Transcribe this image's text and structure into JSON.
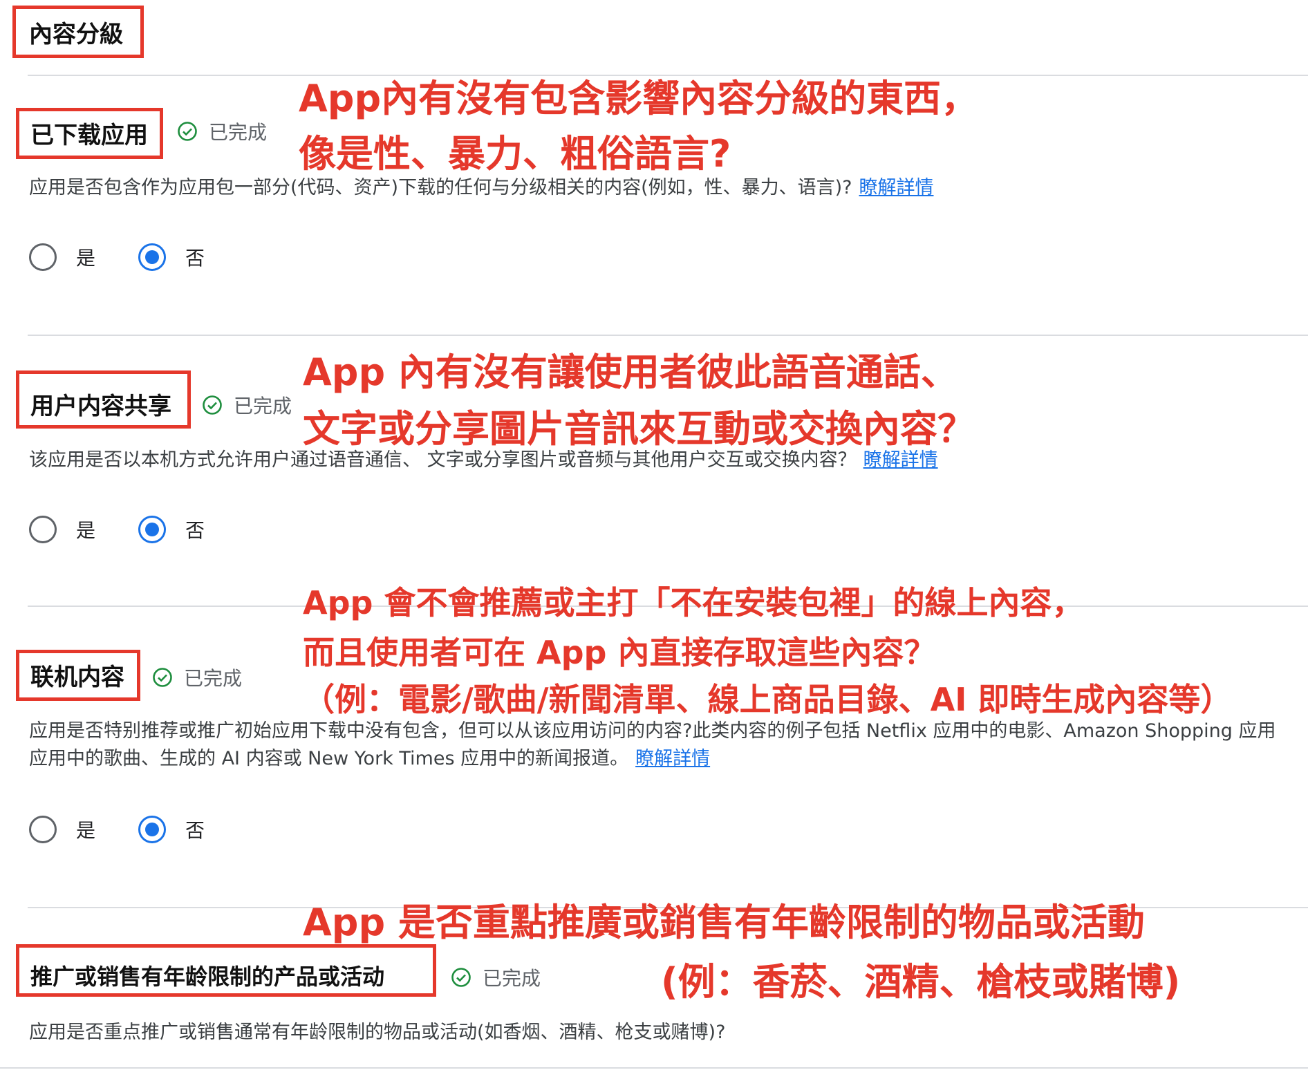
{
  "page_title": "內容分級",
  "sections": [
    {
      "heading": "已下载应用",
      "status": "已完成",
      "description": "应用是否包含作为应用包一部分(代码、资产)下载的任何与分级相关的内容(例如，性、暴力、语言)?",
      "link": "瞭解詳情",
      "options": [
        "是",
        "否"
      ],
      "selected": "否",
      "annotation": [
        "App內有沒有包含影響內容分級的東西，",
        "像是性、暴力、粗俗語言?"
      ]
    },
    {
      "heading": "用户内容共享",
      "status": "已完成",
      "description": "该应用是否以本机方式允许用户通过语音通信、 文字或分享图片或音频与其他用户交互或交换内容？",
      "link": "瞭解詳情",
      "options": [
        "是",
        "否"
      ],
      "selected": "否",
      "annotation": [
        "App 內有沒有讓使用者彼此語音通話、",
        "文字或分享圖片音訊來互動或交換內容？"
      ]
    },
    {
      "heading": "联机内容",
      "status": "已完成",
      "description_line1": "应用是否特别推荐或推广初始应用下载中没有包含，但可以从该应用访问的内容?此类内容的例子包括 Netflix 应用中的电影、Amazon Shopping 应用",
      "description_line2": "应用中的歌曲、生成的 AI 内容或 New York Times 应用中的新闻报道。",
      "link": "瞭解詳情",
      "options": [
        "是",
        "否"
      ],
      "selected": "否",
      "annotation": [
        "App 會不會推薦或主打「不在安裝包裡」的線上內容，",
        "而且使用者可在 App 內直接存取這些內容？",
        "（例：電影/歌曲/新聞清單、線上商品目錄、AI 即時生成內容等）"
      ]
    },
    {
      "heading": "推广或销售有年龄限制的产品或活动",
      "status": "已完成",
      "description": "应用是否重点推广或销售通常有年龄限制的物品或活动(如香烟、酒精、枪支或赌博)?",
      "annotation": [
        "App 是否重點推廣或銷售有年齡限制的物品或活動",
        "(例：香菸、酒精、槍枝或賭博)"
      ]
    }
  ],
  "colors": {
    "annotation_red": "#e5382b",
    "radio_blue": "#1a73e8",
    "check_green": "#1e8e3e"
  }
}
